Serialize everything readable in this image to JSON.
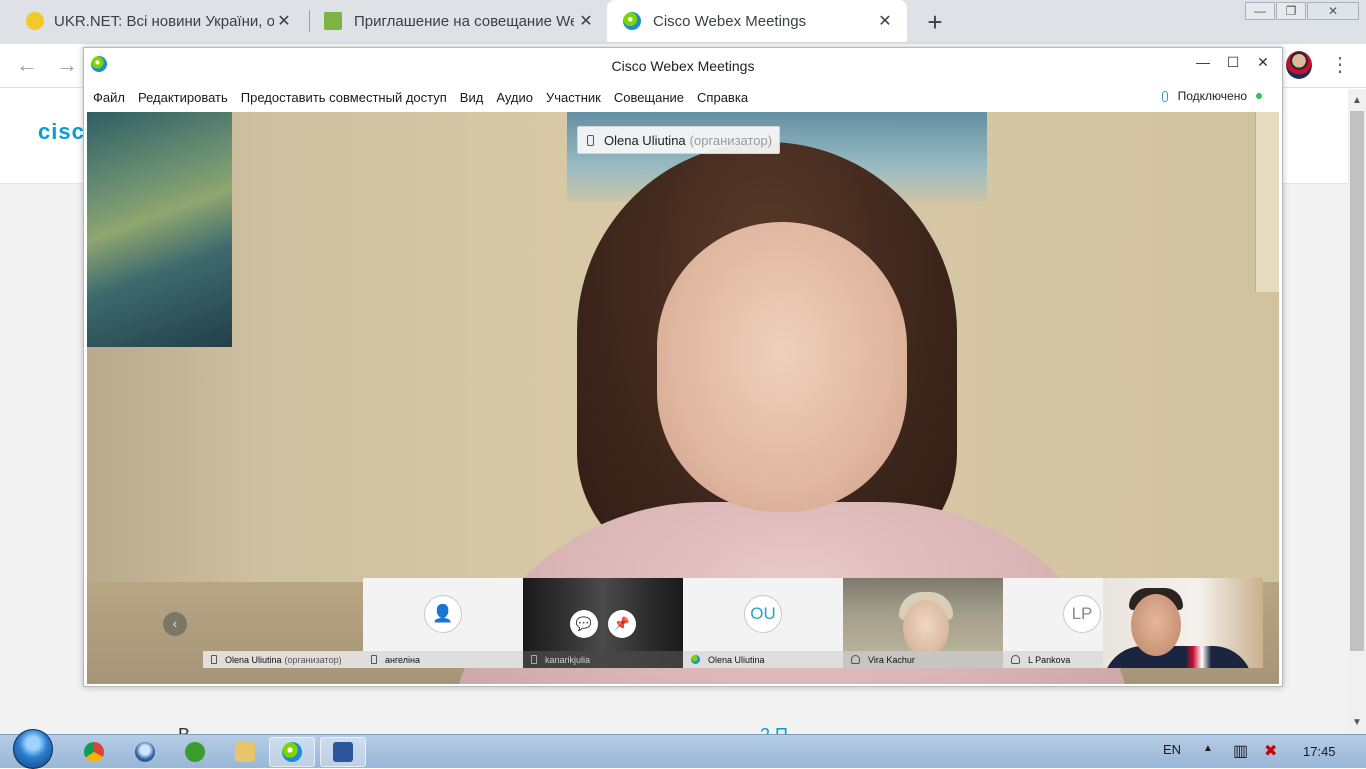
{
  "browser": {
    "tabs": [
      {
        "title": "UKR.NET: Всі новини України, ос",
        "icon": "ukrnet-icon"
      },
      {
        "title": "Приглашение на совещание We",
        "icon": "envelope-icon"
      },
      {
        "title": "Cisco Webex Meetings",
        "icon": "webex-icon"
      }
    ],
    "close_glyph": "✕",
    "new_tab_glyph": "+",
    "back_glyph": "←",
    "forward_glyph": "→",
    "menu_glyph": "⋮"
  },
  "page": {
    "logo_text": "cisco",
    "bottom_left_text": "В",
    "bottom_right_text": "2 П"
  },
  "webex": {
    "window_title": "Cisco Webex Meetings",
    "menu": [
      "Файл",
      "Редактировать",
      "Предоставить совместный доступ",
      "Вид",
      "Аудио",
      "Участник",
      "Совещание",
      "Справка"
    ],
    "status": "Подключено",
    "colors": {
      "status": "#2ec24f",
      "accent": "#2aa3c5"
    },
    "active_speaker": {
      "name": "Olena Uliutina",
      "role": "(организатор)"
    },
    "prev_glyph": "‹",
    "participants": [
      {
        "name": "Olena Uliutina",
        "role": "(организатор)",
        "audio": "phone",
        "type": "video-stage"
      },
      {
        "name": "ангеліна",
        "role": "",
        "audio": "phone",
        "type": "avatar-placeholder"
      },
      {
        "name": "kanarikjulia",
        "role": "",
        "audio": "phone",
        "type": "video-dark"
      },
      {
        "name": "Olena Uliutina",
        "role": "",
        "audio": "webex",
        "type": "initials",
        "initials": "OU"
      },
      {
        "name": "Vira Kachur",
        "role": "",
        "audio": "headset",
        "type": "video"
      },
      {
        "name": "L Pankova",
        "role": "",
        "audio": "headset",
        "type": "initials",
        "initials": "LP"
      }
    ],
    "hover_buttons": [
      "chat-icon",
      "pin-icon"
    ]
  },
  "taskbar": {
    "apps": [
      "chrome-icon",
      "thunderbird-icon",
      "utorrent-icon",
      "explorer-icon",
      "webex-icon",
      "word-icon"
    ],
    "language": "EN",
    "clock": "17:45"
  }
}
